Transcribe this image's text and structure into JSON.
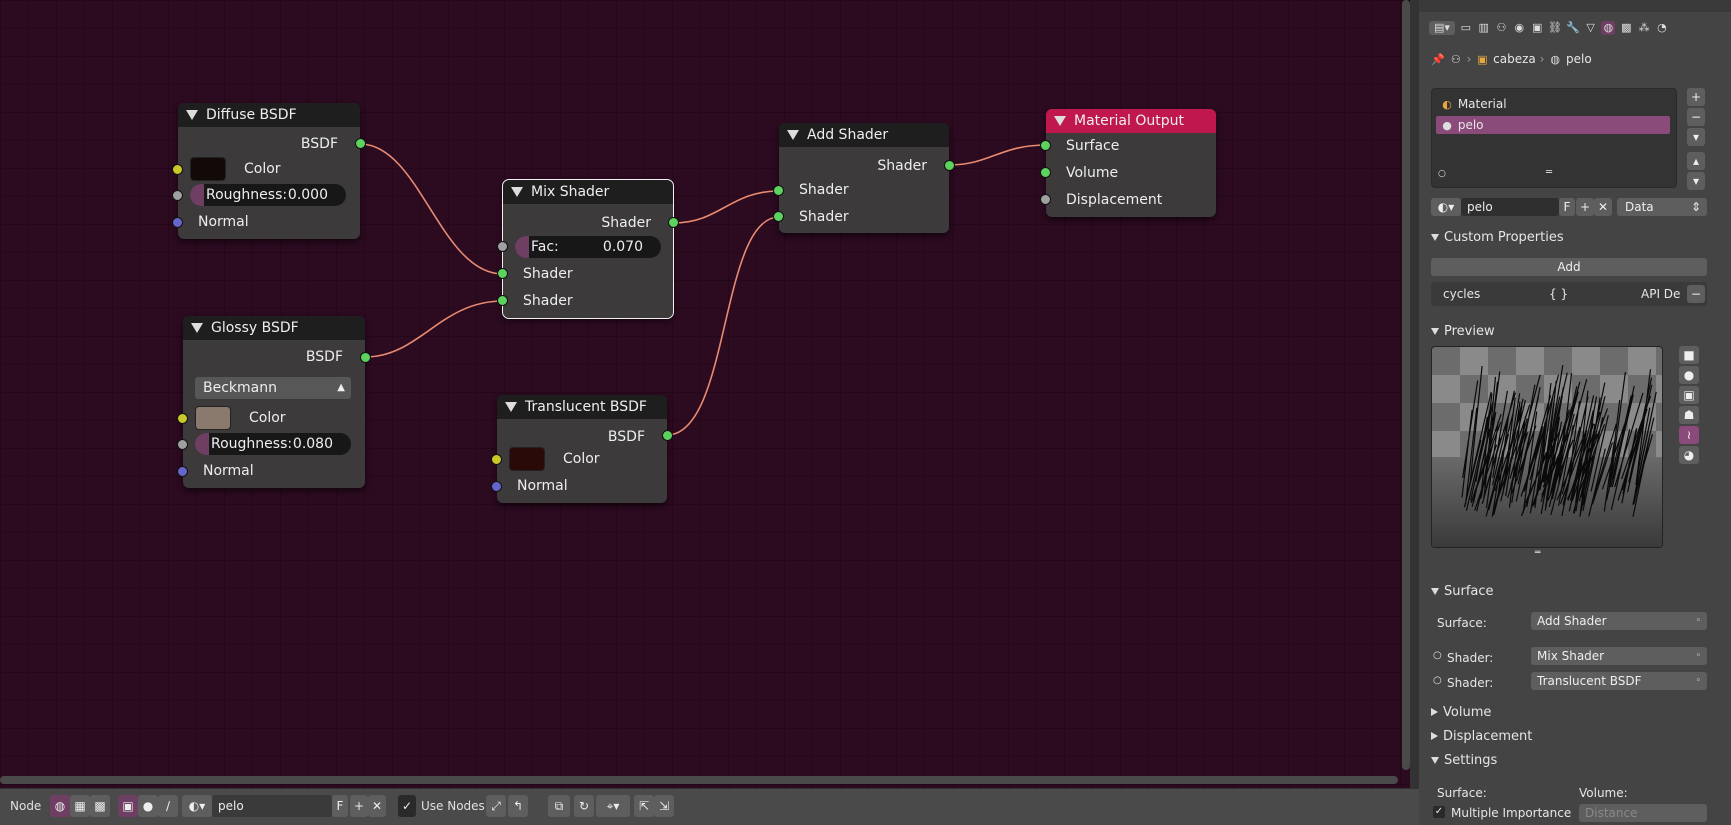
{
  "node_editor": {
    "nodes": {
      "diffuse": {
        "title": "Diffuse BSDF",
        "output": "BSDF",
        "color_label": "Color",
        "rough_label": "Roughness:",
        "rough_value": "0.000",
        "normal_label": "Normal",
        "color_swatch": "#140909"
      },
      "glossy": {
        "title": "Glossy BSDF",
        "output": "BSDF",
        "distribution": "Beckmann",
        "color_label": "Color",
        "rough_label": "Roughness:",
        "rough_value": "0.080",
        "normal_label": "Normal",
        "color_swatch": "#8a7a6e"
      },
      "mix": {
        "title": "Mix Shader",
        "output": "Shader",
        "fac_label": "Fac:",
        "fac_value": "0.070",
        "in1": "Shader",
        "in2": "Shader"
      },
      "translucent": {
        "title": "Translucent BSDF",
        "output": "BSDF",
        "color_label": "Color",
        "normal_label": "Normal",
        "color_swatch": "#2a0a08"
      },
      "add": {
        "title": "Add Shader",
        "output": "Shader",
        "in1": "Shader",
        "in2": "Shader"
      },
      "output": {
        "title": "Material Output",
        "in1": "Surface",
        "in2": "Volume",
        "in3": "Displacement"
      }
    }
  },
  "footer": {
    "menu_node": "Node",
    "material_name": "pelo",
    "fake_user": "F",
    "use_nodes_label": "Use Nodes",
    "use_nodes_checked": true
  },
  "properties": {
    "breadcrumb": {
      "object": "cabeza",
      "material": "pelo"
    },
    "slots": {
      "header": "Material",
      "selected": "pelo"
    },
    "datablock": {
      "name": "pelo",
      "fake_user": "F",
      "link": "Data"
    },
    "custom_properties": {
      "title": "Custom Properties",
      "add_label": "Add",
      "prop_name": "cycles",
      "prop_value": "{ }",
      "prop_api": "API De"
    },
    "preview": {
      "title": "Preview"
    },
    "surface": {
      "title": "Surface",
      "surface_label": "Surface:",
      "surface_value": "Add Shader",
      "shader1_label": "Shader:",
      "shader1_value": "Mix Shader",
      "shader2_label": "Shader:",
      "shader2_value": "Translucent BSDF"
    },
    "volume_title": "Volume",
    "displacement_title": "Displacement",
    "settings": {
      "title": "Settings",
      "surface_label": "Surface:",
      "volume_label": "Volume:",
      "mis_label": "Multiple Importance",
      "volume_dd": "Distance"
    }
  },
  "colors": {
    "editor_bg": "#2c0a20",
    "output_header": "#c0174f",
    "selected_slot": "#8a4a7a",
    "wire": "#e88a70"
  }
}
